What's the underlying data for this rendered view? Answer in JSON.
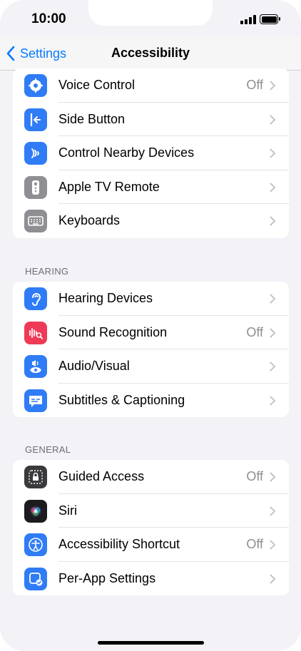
{
  "status_bar": {
    "time": "10:00"
  },
  "nav": {
    "back_label": "Settings",
    "title": "Accessibility"
  },
  "group1": {
    "items": [
      {
        "label": "Voice Control",
        "value": "Off",
        "icon": "voice-control-icon",
        "color": "#2f7cf6"
      },
      {
        "label": "Side Button",
        "value": "",
        "icon": "side-button-icon",
        "color": "#2f7cf6"
      },
      {
        "label": "Control Nearby Devices",
        "value": "",
        "icon": "control-nearby-devices-icon",
        "color": "#2f7cf6"
      },
      {
        "label": "Apple TV Remote",
        "value": "",
        "icon": "apple-tv-remote-icon",
        "color": "#8e8e93"
      },
      {
        "label": "Keyboards",
        "value": "",
        "icon": "keyboard-icon",
        "color": "#8e8e93"
      }
    ]
  },
  "hearing": {
    "header": "HEARING",
    "items": [
      {
        "label": "Hearing Devices",
        "value": "",
        "icon": "ear-icon",
        "color": "#2f7cf6"
      },
      {
        "label": "Sound Recognition",
        "value": "Off",
        "icon": "sound-recognition-icon",
        "color": "#ee3a56"
      },
      {
        "label": "Audio/Visual",
        "value": "",
        "icon": "audio-visual-icon",
        "color": "#2f7cf6"
      },
      {
        "label": "Subtitles & Captioning",
        "value": "",
        "icon": "subtitles-icon",
        "color": "#2f7cf6"
      }
    ]
  },
  "general": {
    "header": "GENERAL",
    "items": [
      {
        "label": "Guided Access",
        "value": "Off",
        "icon": "guided-access-icon",
        "color": "#3a3a3c"
      },
      {
        "label": "Siri",
        "value": "",
        "icon": "siri-icon",
        "color": "#1c1c1e"
      },
      {
        "label": "Accessibility Shortcut",
        "value": "Off",
        "icon": "accessibility-icon",
        "color": "#2f7cf6"
      },
      {
        "label": "Per-App Settings",
        "value": "",
        "icon": "per-app-settings-icon",
        "color": "#2f7cf6"
      }
    ]
  }
}
